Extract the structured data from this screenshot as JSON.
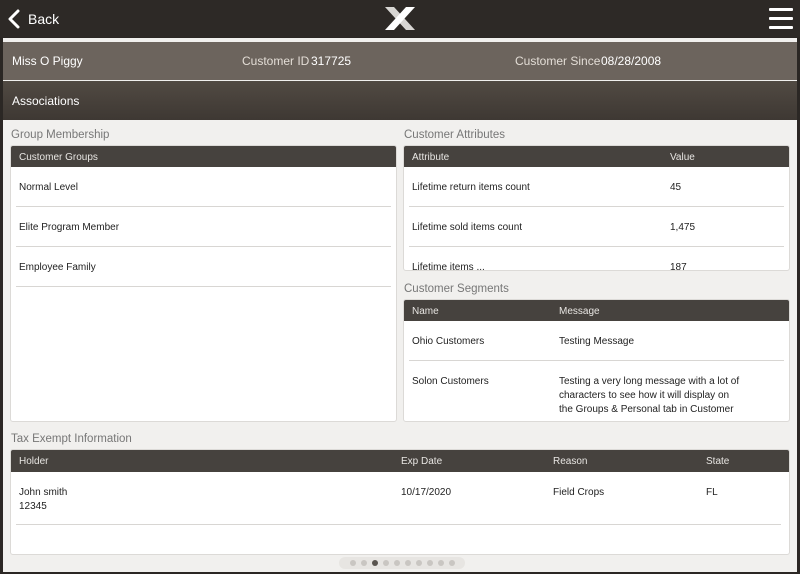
{
  "nav": {
    "back_label": "Back"
  },
  "customer": {
    "name": "Miss O Piggy",
    "id_label": "Customer ID",
    "id_value": "317725",
    "since_label": "Customer Since",
    "since_value": "08/28/2008"
  },
  "tab_title": "Associations",
  "group_membership": {
    "title": "Group Membership",
    "header": "Customer Groups",
    "items": [
      "Normal Level",
      "Elite Program Member",
      "Employee Family"
    ]
  },
  "customer_attributes": {
    "title": "Customer Attributes",
    "col_attribute": "Attribute",
    "col_value": "Value",
    "rows": [
      {
        "attribute": "Lifetime return items count",
        "value": "45"
      },
      {
        "attribute": "Lifetime sold items count",
        "value": "1,475"
      },
      {
        "attribute": "Lifetime items ...",
        "value": "187"
      }
    ]
  },
  "customer_segments": {
    "title": "Customer Segments",
    "col_name": "Name",
    "col_message": "Message",
    "rows": [
      {
        "name": "Ohio Customers",
        "message": "Testing Message"
      },
      {
        "name": "Solon Customers",
        "message_lines": [
          "Testing a very long message with a lot of",
          "characters to see how it will display on",
          "the Groups & Personal tab in Customer"
        ]
      }
    ]
  },
  "tax_exempt": {
    "title": "Tax Exempt Information",
    "col_holder": "Holder",
    "col_exp": "Exp Date",
    "col_reason": "Reason",
    "col_state": "State",
    "rows": [
      {
        "holder": "John smith",
        "holder_id": "12345",
        "exp_date": "10/17/2020",
        "reason": "Field Crops",
        "state": "FL"
      }
    ]
  },
  "pager": {
    "count": 10,
    "active_index": 2
  },
  "colors": {
    "header_bar": "#6c645d",
    "table_header": "#46423e",
    "background": "#f1f0ee"
  },
  "icons": {
    "back": "chevron-left-icon",
    "logo": "x-logo",
    "menu": "hamburger-menu-icon"
  }
}
